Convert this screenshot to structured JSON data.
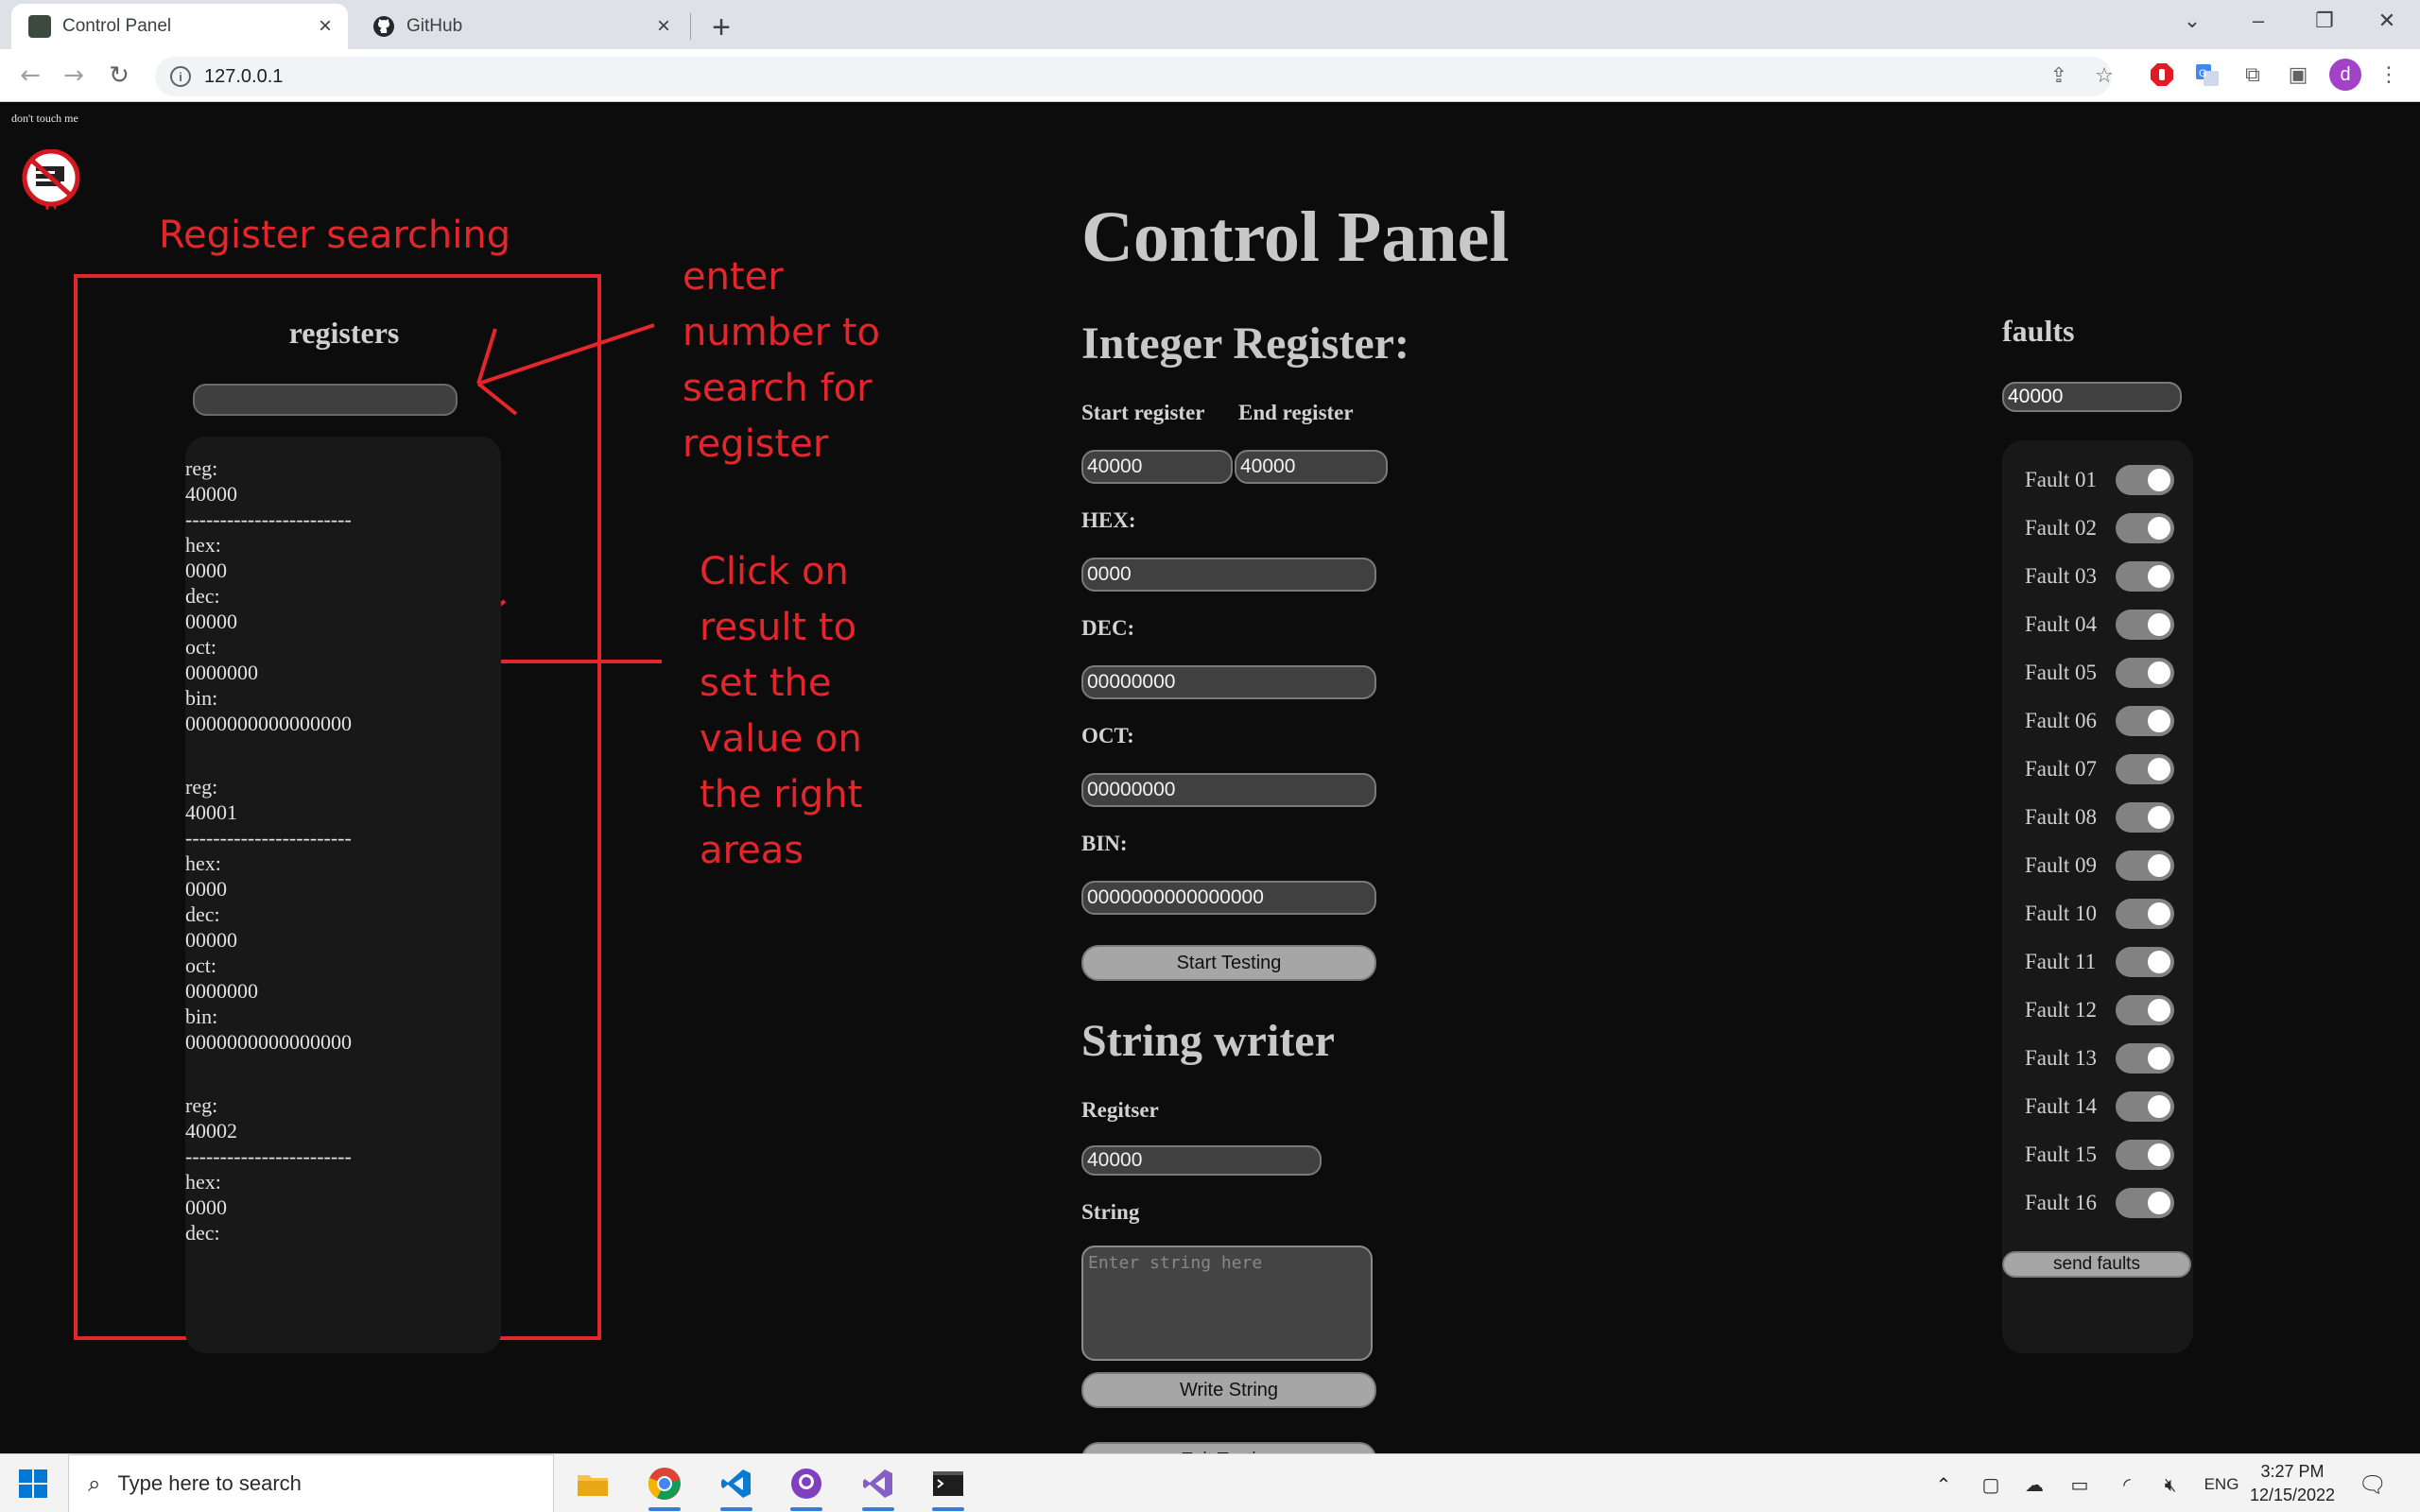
{
  "browser": {
    "tabs": [
      {
        "title": "Control Panel",
        "active": true
      },
      {
        "title": "GitHub",
        "active": false
      }
    ],
    "url": "127.0.0.1",
    "profile_initial": "d"
  },
  "page": {
    "dont_touch": "don't touch me",
    "title": "Control Panel",
    "registers": {
      "heading": "registers",
      "search_value": "",
      "results": [
        {
          "reg_label": "reg:",
          "reg": "40000",
          "divider": "------------------------",
          "hex_label": "hex:",
          "hex": "0000",
          "dec_label": "dec:",
          "dec": "00000",
          "oct_label": "oct:",
          "oct": "0000000",
          "bin_label": "bin:",
          "bin": "0000000000000000"
        },
        {
          "reg_label": "reg:",
          "reg": "40001",
          "divider": "------------------------",
          "hex_label": "hex:",
          "hex": "0000",
          "dec_label": "dec:",
          "dec": "00000",
          "oct_label": "oct:",
          "oct": "0000000",
          "bin_label": "bin:",
          "bin": "0000000000000000"
        },
        {
          "reg_label": "reg:",
          "reg": "40002",
          "divider": "------------------------",
          "hex_label": "hex:",
          "hex": "0000",
          "dec_label": "dec:",
          "dec": "",
          "oct_label": "",
          "oct": "",
          "bin_label": "",
          "bin": ""
        }
      ]
    },
    "integer_register": {
      "heading": "Integer Register:",
      "start_label": "Start register",
      "end_label": "End register",
      "start_value": "40000",
      "end_value": "40000",
      "hex_label": "HEX:",
      "hex_value": "0000",
      "dec_label": "DEC:",
      "dec_value": "00000000",
      "oct_label": "OCT:",
      "oct_value": "00000000",
      "bin_label": "BIN:",
      "bin_value": "0000000000000000",
      "start_testing": "Start Testing"
    },
    "string_writer": {
      "heading": "String writer",
      "register_label": "Regitser",
      "register_value": "40000",
      "string_label": "String",
      "string_placeholder": "Enter string here",
      "write_button": "Write String",
      "exit_button": "Exit Testing"
    },
    "faults": {
      "heading": "faults",
      "register_value": "40000",
      "items": [
        "Fault 01",
        "Fault 02",
        "Fault 03",
        "Fault 04",
        "Fault 05",
        "Fault 06",
        "Fault 07",
        "Fault 08",
        "Fault 09",
        "Fault 10",
        "Fault 11",
        "Fault 12",
        "Fault 13",
        "Fault 14",
        "Fault 15",
        "Fault 16"
      ],
      "send_button": "send faults"
    }
  },
  "annotations": {
    "box_title": "Register searching",
    "search_hint": [
      "enter",
      "number to",
      "search for",
      "register"
    ],
    "click_hint": [
      "Click on",
      "result to",
      "set the",
      "value on",
      "the right",
      "areas"
    ],
    "color": "#e3262b"
  },
  "taskbar": {
    "search_placeholder": "Type here to search",
    "language": "ENG",
    "time": "3:27 PM",
    "date": "12/15/2022"
  }
}
